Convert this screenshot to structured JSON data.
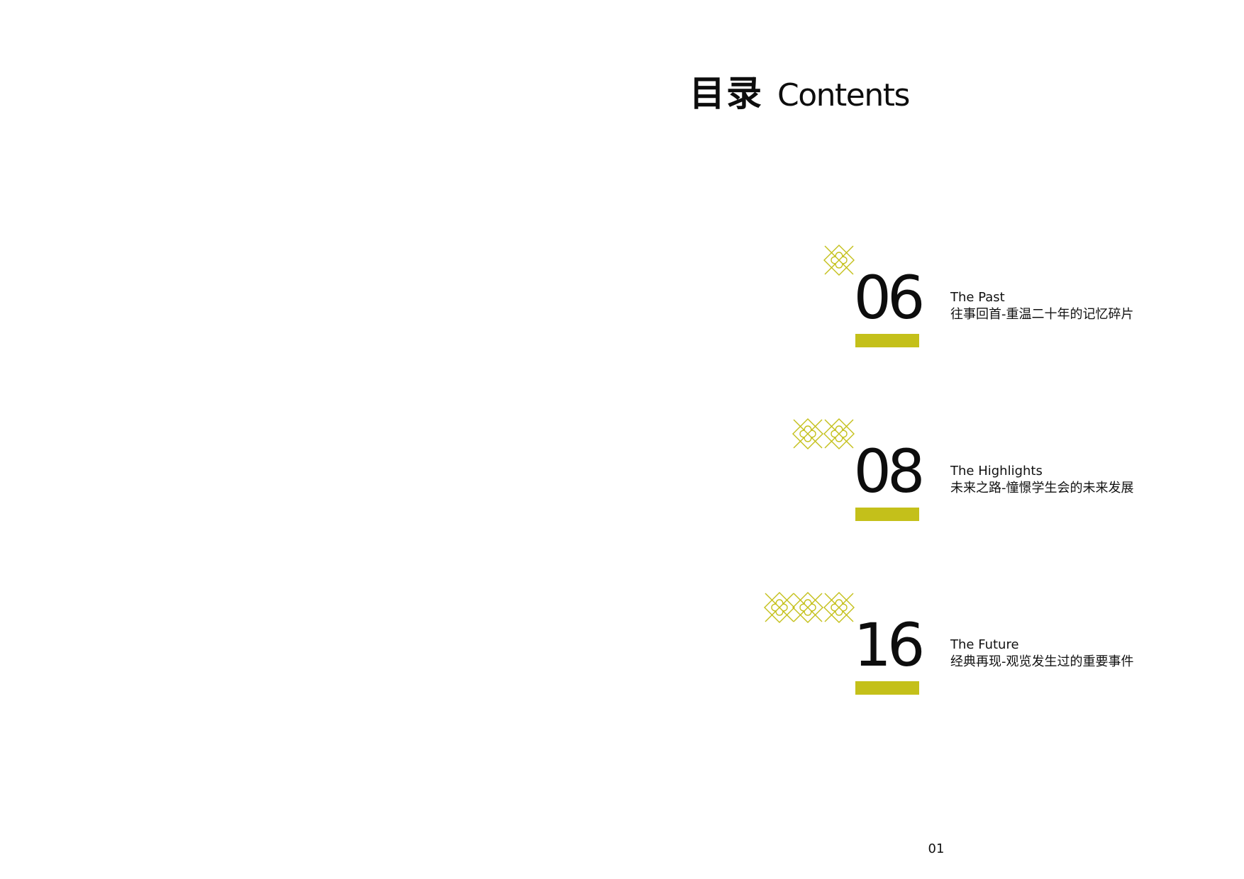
{
  "heading": {
    "cn": "目录",
    "en": "Contents"
  },
  "accent_color": "#c4c01a",
  "entries": [
    {
      "number": "06",
      "title_en": "The Past",
      "title_cn": "往事回首-重温二十年的记忆碎片",
      "icon": "diamond-cross-icon",
      "icon_count": 1
    },
    {
      "number": "08",
      "title_en": "The Highlights",
      "title_cn": "未来之路-憧憬学生会的未来发展",
      "icon": "diamond-cross-icon",
      "icon_count": 2
    },
    {
      "number": "16",
      "title_en": "The Future",
      "title_cn": "经典再现-观览发生过的重要事件",
      "icon": "diamond-cross-icon",
      "icon_count": 3
    }
  ],
  "page_number": "01"
}
